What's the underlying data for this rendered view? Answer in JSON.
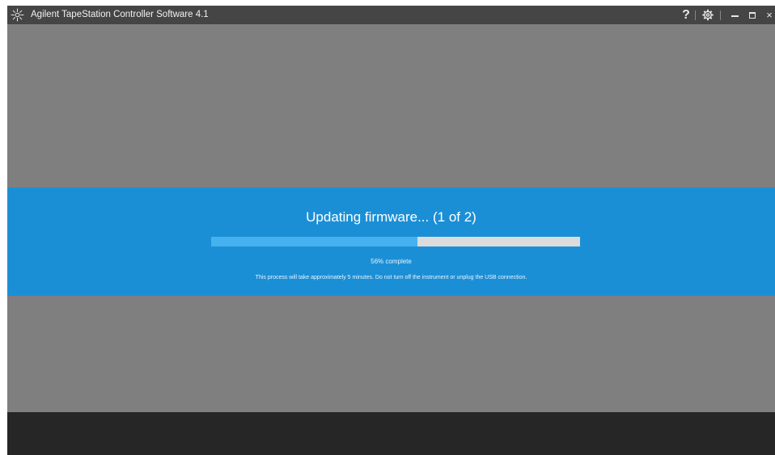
{
  "window": {
    "title": "Agilent TapeStation Controller Software 4.1",
    "logo_icon": "agilent-spark-icon"
  },
  "titlebar": {
    "help_label": "?",
    "help_icon": "help-icon",
    "settings_icon": "gear-icon",
    "minimize_icon": "minimize-icon",
    "maximize_icon": "maximize-icon",
    "close_label": "×",
    "close_icon": "close-icon"
  },
  "firmware_update": {
    "heading": "Updating firmware... (1 of 2)",
    "progress_percent": 56,
    "progress_label": "56% complete",
    "info": "This process will take approximately 5 minutes.  Do not turn off the instrument or unplug the USB connection."
  },
  "colors": {
    "background": "#7f7f7f",
    "titlebar": "#454545",
    "banner": "#1b8fd6",
    "progress_fill": "#45b1ee",
    "progress_track": "#dcdcdc",
    "footer": "#262626"
  }
}
